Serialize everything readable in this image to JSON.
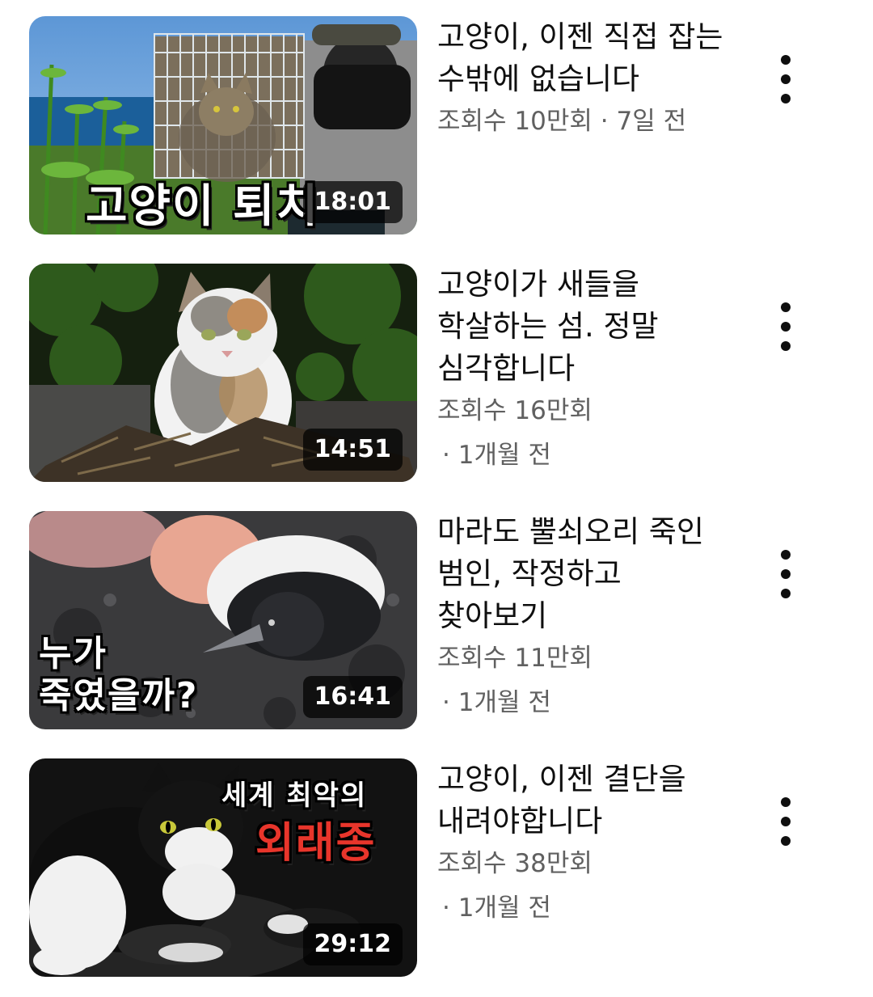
{
  "videos": [
    {
      "title": "고양이, 이젠 직접 잡는 수밖에 없습니다",
      "views": "조회수 10만회",
      "age": "7일 전",
      "duration": "18:01",
      "thumb_text": "고양이 퇴치",
      "thumb_icon": "cat-in-trap-icon"
    },
    {
      "title": "고양이가 새들을 학살하는 섬. 정말 심각합니다",
      "views": "조회수 16만회",
      "age": "1개월 전",
      "duration": "14:51",
      "thumb_icon": "calico-cat-icon"
    },
    {
      "title": "마라도 뿔쇠오리 죽인 범인, 작정하고 찾아보기",
      "views": "조회수 11만회",
      "age": "1개월 전",
      "duration": "16:41",
      "thumb_text_1": "누가",
      "thumb_text_2": "죽였을까?",
      "thumb_icon": "dead-bird-icon"
    },
    {
      "title": "고양이, 이젠 결단을 내려야합니다",
      "views": "조회수 38만회",
      "age": "1개월 전",
      "duration": "29:12",
      "thumb_text_1": "세계 최악의",
      "thumb_text_2": "외래종",
      "thumb_icon": "tuxedo-cat-icon"
    }
  ],
  "more_icon": "more-vertical-icon"
}
